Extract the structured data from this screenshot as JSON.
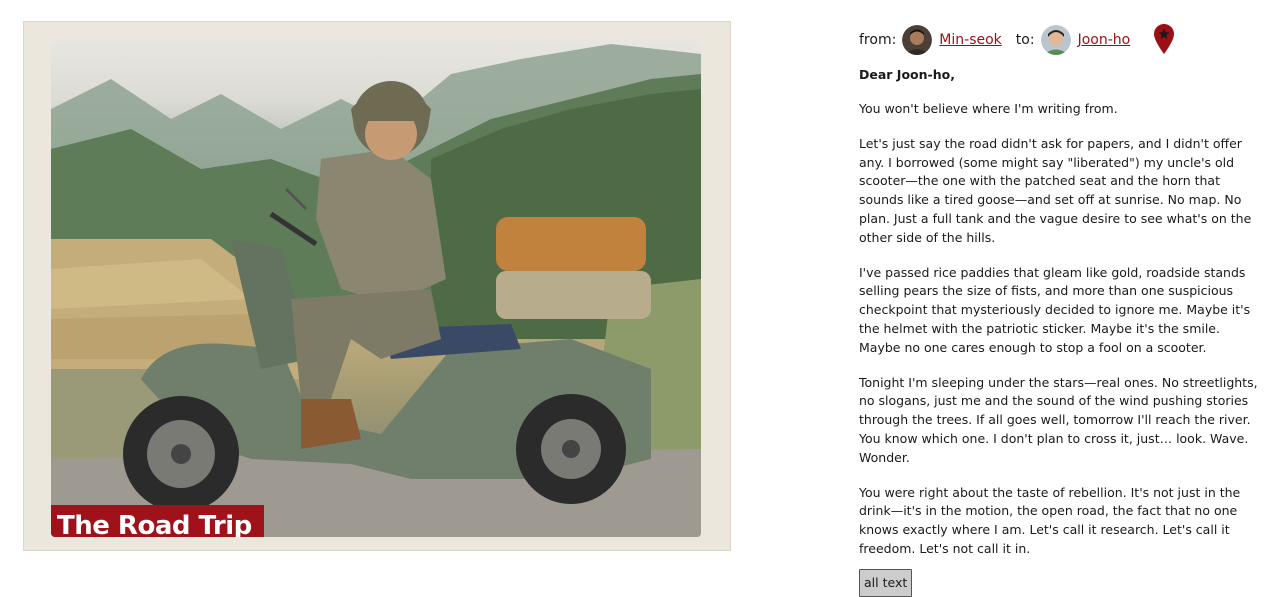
{
  "card": {
    "title": "The Road Trip",
    "image_alt": "man on vintage scooter in mountain countryside"
  },
  "letter": {
    "from_label": "from:",
    "from_name": "Min-seok",
    "to_label": "to:",
    "to_name": "Joon-ho",
    "greeting": "Dear Joon-ho,",
    "paragraphs": [
      "You won't believe where I'm writing from.",
      "Let's just say the road didn't ask for papers, and I didn't offer any. I borrowed (some might say \"liberated\") my uncle's old scooter—the one with the patched seat and the horn that sounds like a tired goose—and set off at sunrise. No map. No plan. Just a full tank and the vague desire to see what's on the other side of the hills.",
      "I've passed rice paddies that gleam like gold, roadside stands selling pears the size of fists, and more than one suspicious checkpoint that mysteriously decided to ignore me. Maybe it's the helmet with the patriotic sticker. Maybe it's the smile. Maybe no one cares enough to stop a fool on a scooter.",
      "Tonight I'm sleeping under the stars—real ones. No streetlights, no slogans, just me and the sound of the wind pushing stories through the trees. If all goes well, tomorrow I'll reach the river. You know which one. I don't plan to cross it, just… look. Wave. Wonder.",
      "You were right about the taste of rebellion. It's not just in the drink—it's in the motion, the open road, the fact that no one knows exactly where I am. Let's call it research. Let's call it freedom. Let's not call it in."
    ],
    "all_text_button": "all text"
  },
  "colors": {
    "accent": "#9b1014",
    "banner": "#a0121a"
  }
}
